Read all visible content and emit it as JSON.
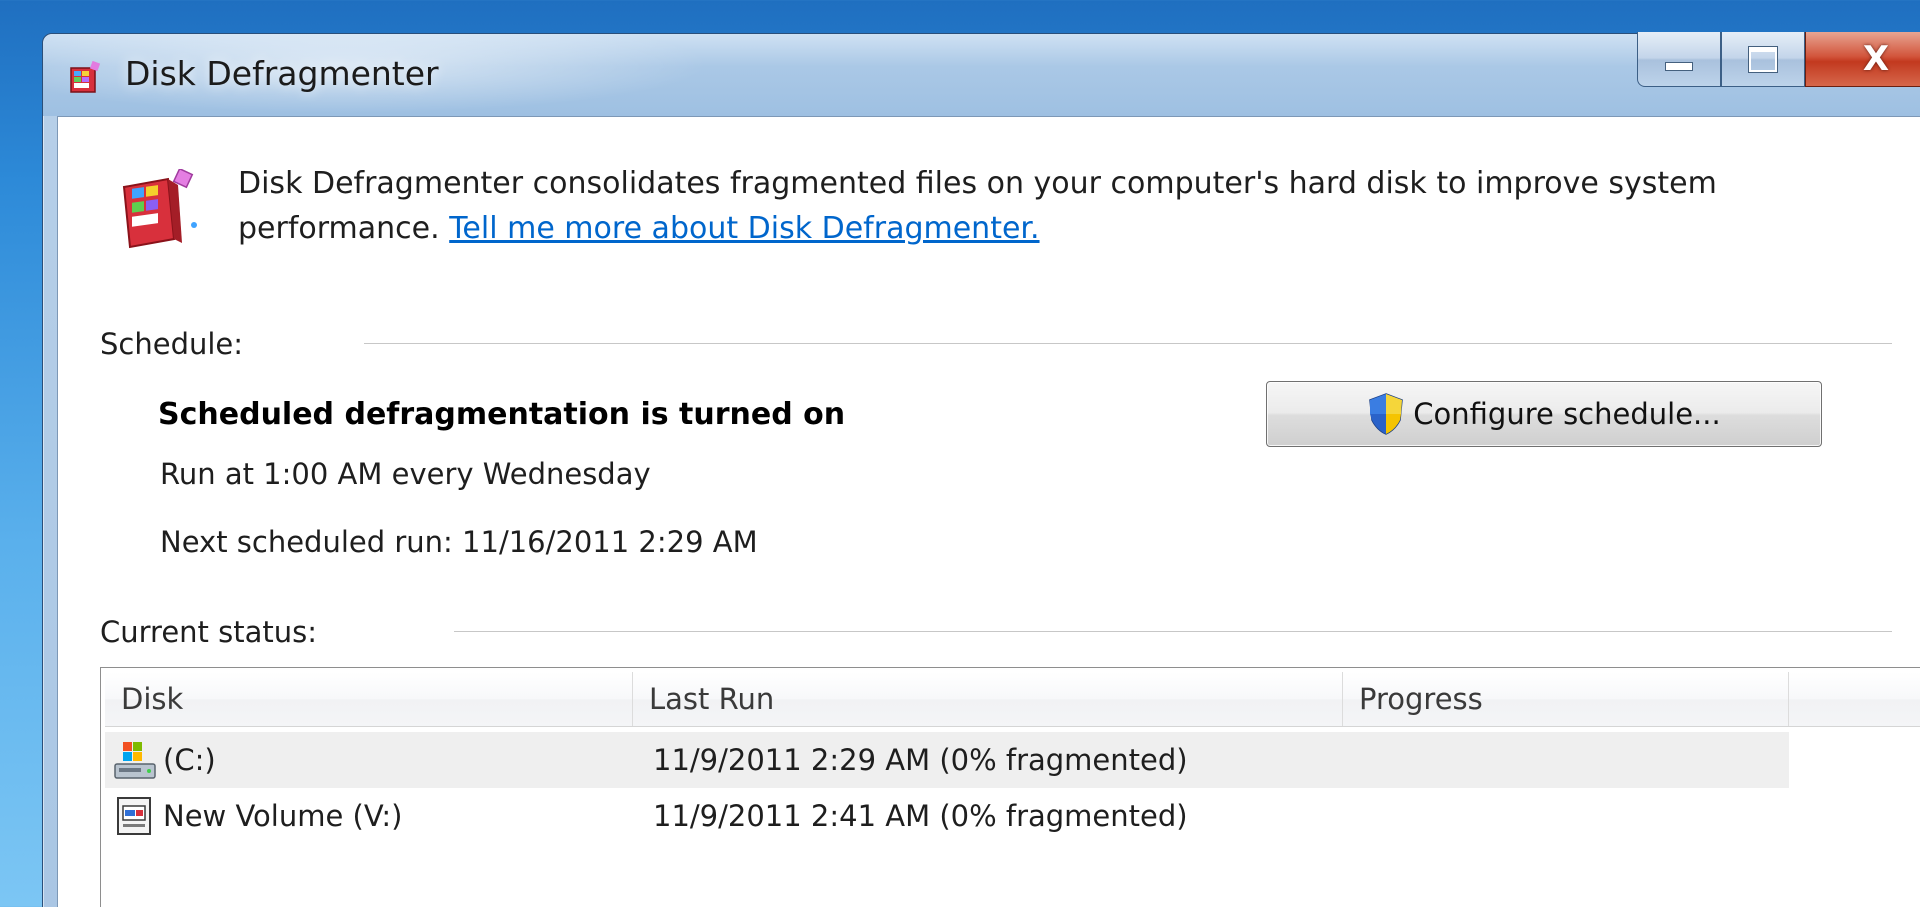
{
  "window": {
    "title": "Disk Defragmenter",
    "close_glyph": "X"
  },
  "intro": {
    "text": "Disk Defragmenter consolidates fragmented files on your computer's hard disk to improve system performance. ",
    "link": "Tell me more about Disk Defragmenter."
  },
  "schedule": {
    "label": "Schedule:",
    "status_title": "Scheduled defragmentation is turned on",
    "run_text": "Run at 1:00 AM every Wednesday",
    "next_run": "Next scheduled run: 11/16/2011 2:29 AM",
    "configure_button": "Configure schedule..."
  },
  "current_status": {
    "label": "Current status:",
    "columns": [
      "Disk",
      "Last Run",
      "Progress"
    ],
    "rows": [
      {
        "disk": "(C:)",
        "last_run": "11/9/2011 2:29 AM (0% fragmented)",
        "progress": "",
        "icon": "system-drive-icon"
      },
      {
        "disk": "New Volume (V:)",
        "last_run": "11/9/2011 2:41 AM (0% fragmented)",
        "progress": "",
        "icon": "volume-drive-icon"
      }
    ]
  },
  "colors": {
    "link": "#0066cc",
    "close_button": "#c2391f",
    "selected_row": "#efefef"
  }
}
